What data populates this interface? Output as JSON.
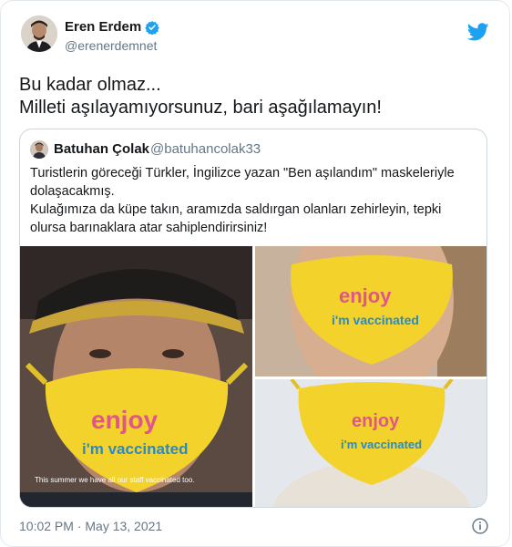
{
  "author": {
    "name": "Eren Erdem",
    "handle": "@erenerdemnet"
  },
  "tweet": {
    "lines": [
      "Bu kadar olmaz...",
      "Milleti aşılayamıyorsunuz, bari aşağılamayın!"
    ]
  },
  "quoted": {
    "name": "Batuhan Çolak",
    "handle": "@batuhancolak33",
    "lines": [
      "Turistlerin göreceği Türkler, İngilizce yazan \"Ben aşılandım\" maskeleriyle",
      "dolaşacakmış.",
      "Kulağımıza da küpe takın, aramızda saldırgan olanları zehirleyin, tepki",
      "olursa barınaklara atar sahiplendirirsiniz!"
    ],
    "media": {
      "mask_word_1": "enjoy",
      "mask_word_2": "i'm vaccinated",
      "caption": "This summer we have all our staff vaccinated too."
    }
  },
  "footer": {
    "timestamp": "10:02 PM · May 13, 2021"
  },
  "colors": {
    "twitter_blue": "#1da1f2",
    "mask_yellow": "#f2d22b",
    "text_secondary": "#657786"
  },
  "icons": [
    "verified-badge-icon",
    "twitter-bird-icon",
    "info-icon"
  ]
}
